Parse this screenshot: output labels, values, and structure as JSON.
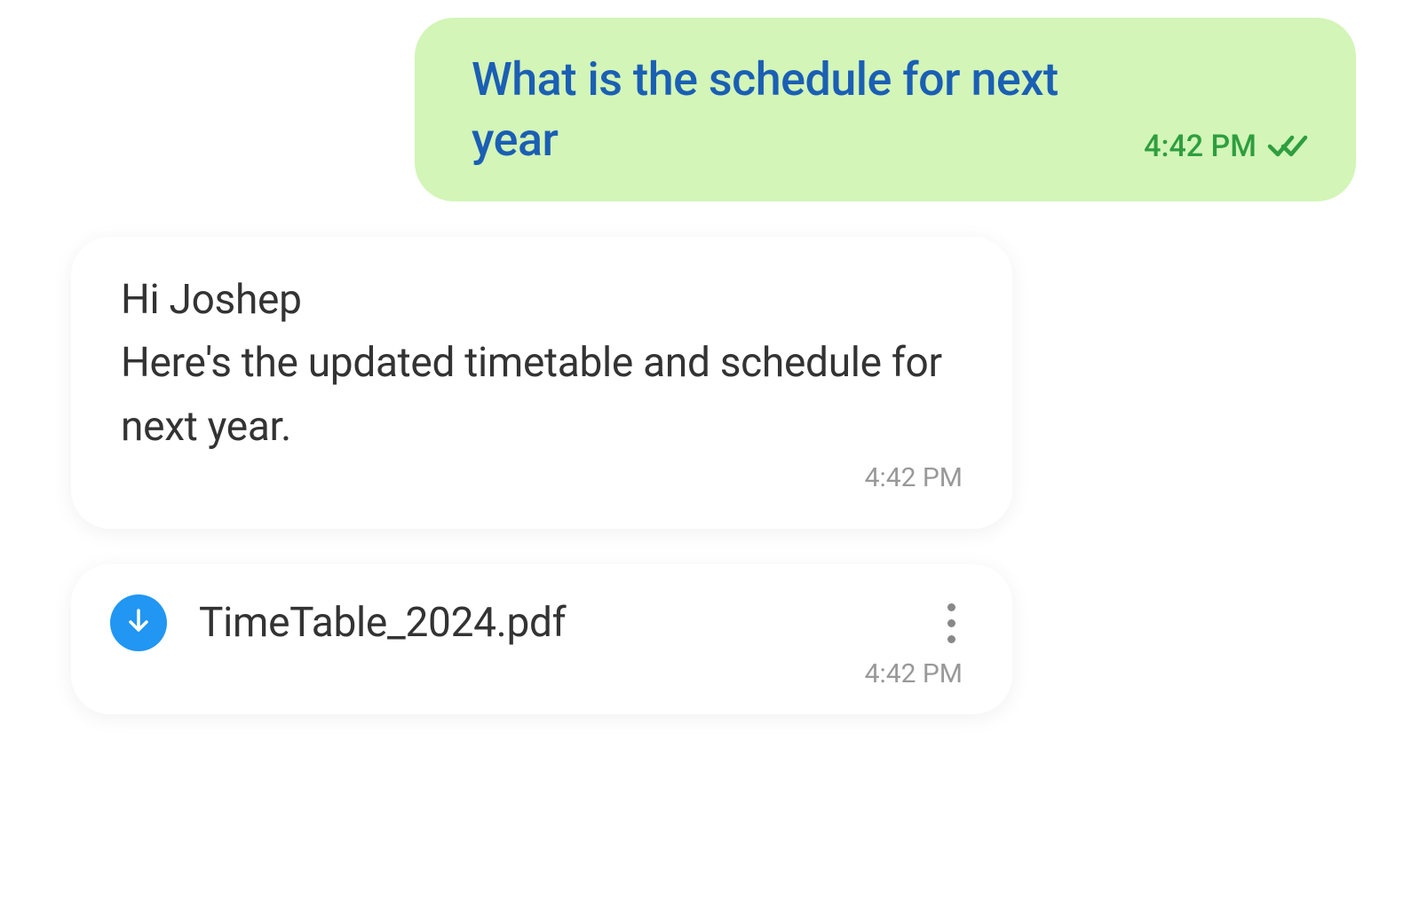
{
  "messages": {
    "sent": {
      "text": "What is the schedule for next year",
      "time": "4:42 PM"
    },
    "received": {
      "text": "Hi Joshep\nHere's the updated timetable and schedule for next year.",
      "time": "4:42 PM"
    },
    "attachment": {
      "filename": "TimeTable_2024.pdf",
      "time": "4:42 PM"
    }
  }
}
